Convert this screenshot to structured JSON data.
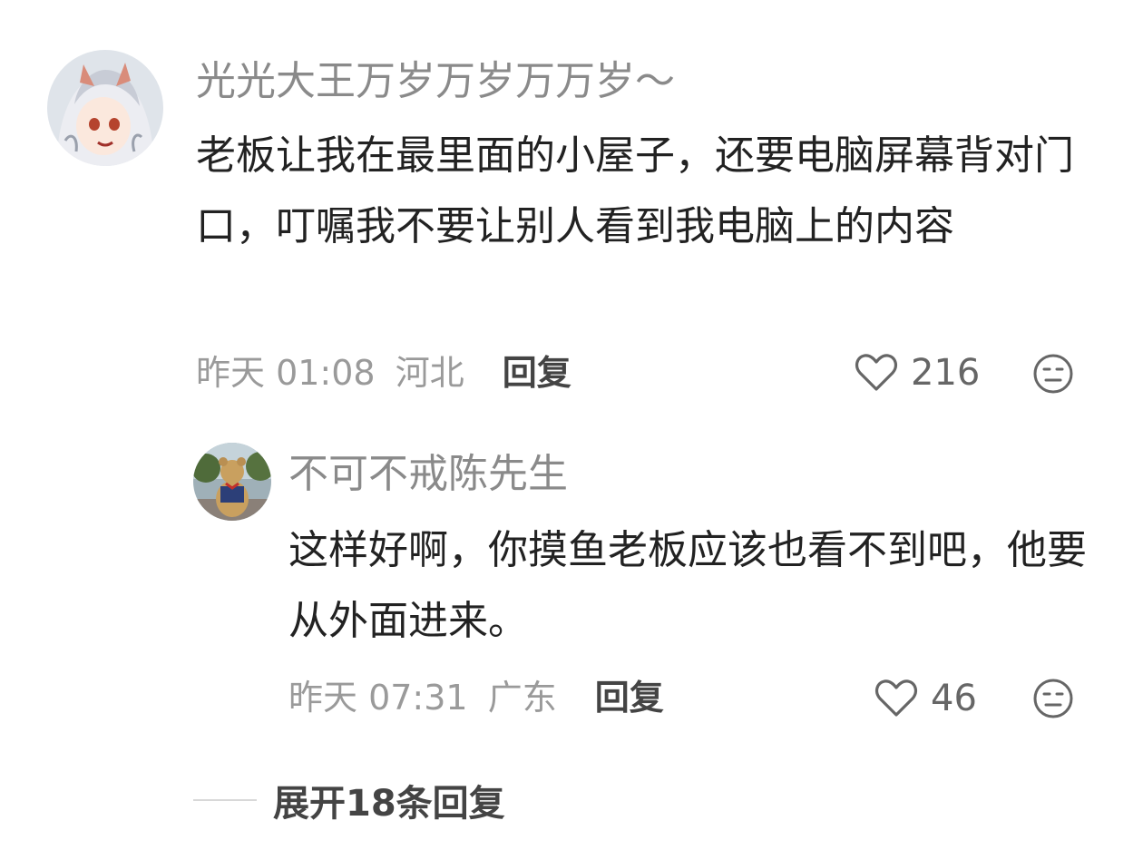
{
  "comments": [
    {
      "username": "光光大王万岁万岁万万岁～",
      "content": "老板让我在最里面的小屋子，还要电脑屏幕背对门口，叮嘱我不要让别人看到我电脑上的内容",
      "time": "昨天 01:08",
      "region": "河北",
      "reply_label": "回复",
      "likes": "216"
    },
    {
      "username": "不可不戒陈先生",
      "content": "这样好啊，你摸鱼老板应该也看不到吧，他要从外面进来。",
      "time": "昨天 07:31",
      "region": "广东",
      "reply_label": "回复",
      "likes": "46"
    }
  ],
  "expand_label": "展开18条回复",
  "icons": {
    "like": "heart-outline-icon",
    "dislike": "meh-face-icon"
  },
  "colors": {
    "username": "#8a8a8a",
    "content": "#222222",
    "meta": "#9a9a9a",
    "action": "#444444"
  }
}
